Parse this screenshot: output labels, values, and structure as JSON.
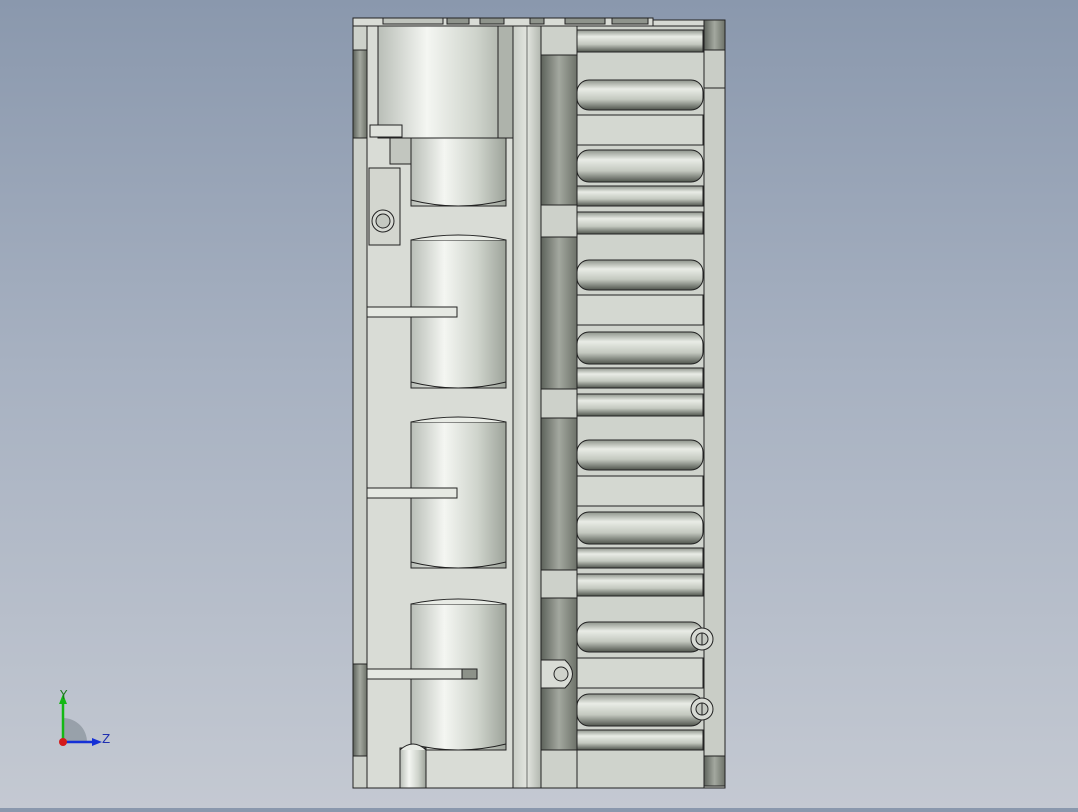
{
  "triad": {
    "y_label": "Y",
    "z_label": "Z",
    "y_color": "#14b814",
    "z_color": "#1530d6",
    "x_color": "#d41a1a"
  },
  "model": {
    "fill": "#d7dbd5",
    "edge": "#1a1a1a",
    "cylinder_highlight": "#ffffff",
    "shade": "#5e625c"
  }
}
